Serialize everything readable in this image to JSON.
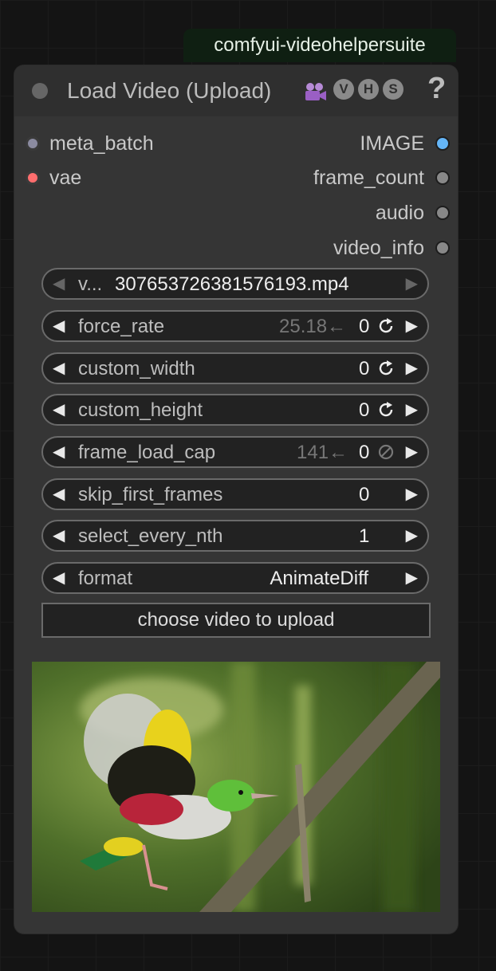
{
  "badge": {
    "label": "comfyui-videohelpersuite"
  },
  "node": {
    "title": "Load Video (Upload)",
    "vhs": [
      "V",
      "H",
      "S"
    ],
    "help": "?",
    "inputs": [
      {
        "label": "meta_batch",
        "color": "#8b8ba0"
      },
      {
        "label": "vae",
        "color": "#ff6e6e"
      }
    ],
    "outputs": [
      {
        "label": "IMAGE",
        "color": "#64b5f6"
      },
      {
        "label": "frame_count",
        "color": "#888888"
      },
      {
        "label": "audio",
        "color": "#888888"
      },
      {
        "label": "video_info",
        "color": "#888888"
      }
    ],
    "widgets": {
      "video": {
        "label": "v...",
        "value": "307653726381576193.mp4"
      },
      "force_rate": {
        "label": "force_rate",
        "hint": "25.18←",
        "value": "0"
      },
      "custom_width": {
        "label": "custom_width",
        "value": "0"
      },
      "custom_height": {
        "label": "custom_height",
        "value": "0"
      },
      "frame_load_cap": {
        "label": "frame_load_cap",
        "hint": "141←",
        "value": "0"
      },
      "skip_first_frames": {
        "label": "skip_first_frames",
        "value": "0"
      },
      "select_every_nth": {
        "label": "select_every_nth",
        "value": "1"
      },
      "format": {
        "label": "format",
        "value": "AnimateDiff"
      }
    },
    "upload_button": "choose video to upload"
  }
}
